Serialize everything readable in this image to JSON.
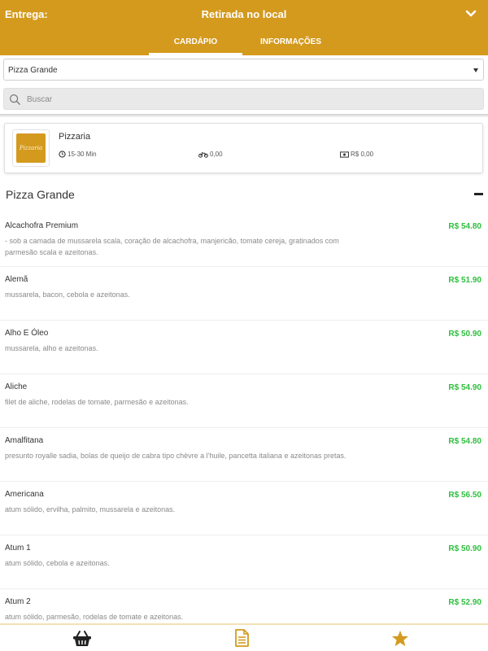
{
  "header": {
    "delivery_label": "Entrega:",
    "delivery_mode": "Retirada no local",
    "tabs": [
      {
        "label": "CARDÁPIO",
        "active": true
      },
      {
        "label": "INFORMAÇÕES",
        "active": false
      }
    ],
    "accent_color": "#d49a1e"
  },
  "category_select": {
    "selected": "Pizza Grande"
  },
  "search": {
    "placeholder": "Buscar"
  },
  "store": {
    "name": "Pizzaria",
    "logo_text": "Pizzaria",
    "delivery_time": "15-30 Min",
    "delivery_fee": "0,00",
    "min_order": "R$ 0,00"
  },
  "section": {
    "title": "Pizza Grande"
  },
  "items": [
    {
      "name": "Alcachofra Premium",
      "price": "R$ 54.80",
      "desc": "- sob a camada de mussarela scala, coração de alcachofra, manjericão, tomate cereja, gratinados com parmesão scala e azeitonas."
    },
    {
      "name": "Alemã",
      "price": "R$ 51.90",
      "desc": "mussarela, bacon, cebola e azeitonas."
    },
    {
      "name": "Alho E Óleo",
      "price": "R$ 50.90",
      "desc": "mussarela, alho e azeitonas."
    },
    {
      "name": "Aliche",
      "price": "R$ 54.90",
      "desc": "filet de aliche, rodelas de tomate, parmesão e azeitonas."
    },
    {
      "name": "Amalfitana",
      "price": "R$ 54.80",
      "desc": "presunto royalle sadia, bolas de queijo de cabra tipo chèvre a l'huile, pancetta italiana e azeitonas pretas."
    },
    {
      "name": "Americana",
      "price": "R$ 56.50",
      "desc": "atum sólido, ervilha, palmito, mussarela e azeitonas."
    },
    {
      "name": "Atum 1",
      "price": "R$ 50.90",
      "desc": "atum sólido, cebola e azeitonas."
    },
    {
      "name": "Atum 2",
      "price": "R$ 52.90",
      "desc": "atum sólido, parmesão, rodelas de tomate e azeitonas."
    }
  ],
  "bottom_nav": [
    {
      "icon": "basket-icon"
    },
    {
      "icon": "document-icon"
    },
    {
      "icon": "star-icon"
    }
  ],
  "price_color": "#2fbf3f"
}
